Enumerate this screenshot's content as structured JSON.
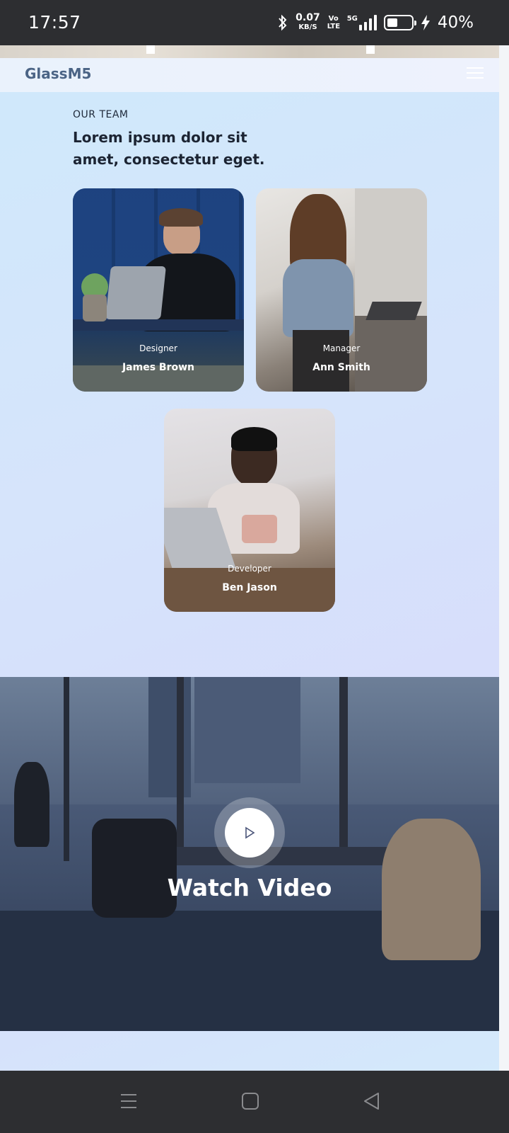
{
  "status_bar": {
    "time": "17:57",
    "net_speed": "0.07",
    "net_unit": "KB/S",
    "volte": "Vo LTE",
    "network": "5G",
    "battery_pct": "40%",
    "battery_level": 0.4
  },
  "site": {
    "brand": "GlassM5"
  },
  "team": {
    "eyebrow": "OUR TEAM",
    "headline": "Lorem ipsum dolor sit amet, consectetur eget.",
    "members": [
      {
        "role": "Designer",
        "name": "James Brown"
      },
      {
        "role": "Manager",
        "name": "Ann Smith"
      },
      {
        "role": "Developer",
        "name": "Ben Jason"
      }
    ]
  },
  "video": {
    "title": "Watch Video"
  },
  "icons": {
    "bluetooth": "bluetooth-icon",
    "signal": "signal-icon",
    "battery": "battery-icon",
    "charging": "charging-icon",
    "menu": "hamburger-menu-icon",
    "play": "play-icon",
    "recents": "recents-icon",
    "home": "home-icon",
    "back": "back-icon"
  }
}
